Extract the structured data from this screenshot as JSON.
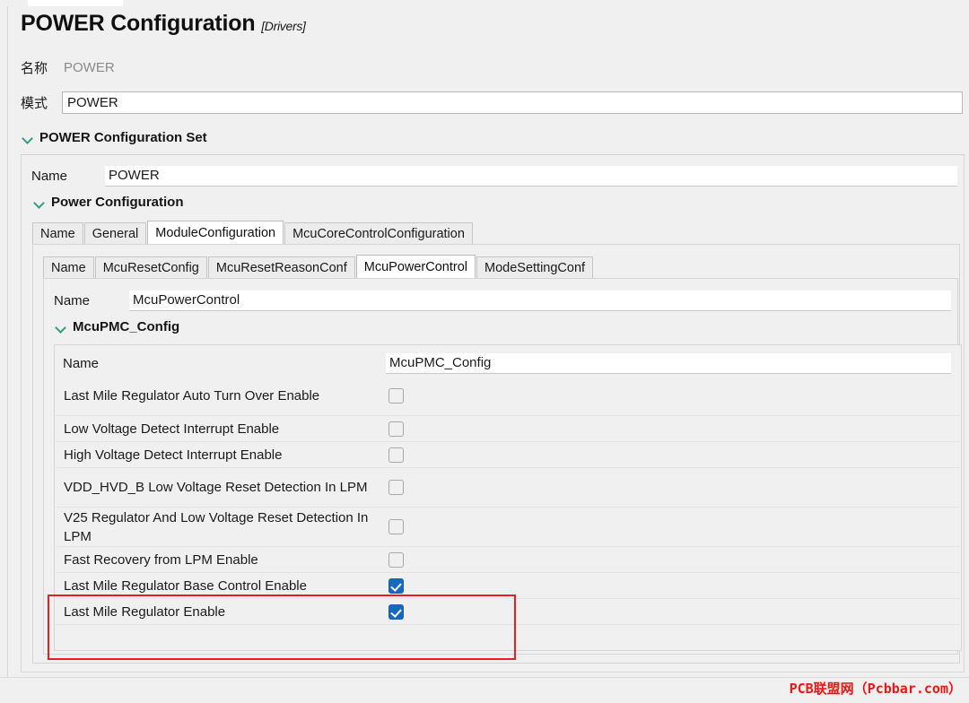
{
  "window": {
    "header_title": "POWER Configuration",
    "header_subtitle": "[Drivers]"
  },
  "form": {
    "name_label": "名称",
    "name_value": "POWER",
    "mode_label": "模式",
    "mode_value": "POWER"
  },
  "sections": {
    "power_configuration_set": "POWER Configuration Set",
    "power_configuration": "Power Configuration",
    "mcu_pmc_config": "McuPMC_Config"
  },
  "rows": {
    "set_name_label": "Name",
    "set_name_value": "POWER",
    "power_control_name_label": "Name",
    "power_control_name_value": "McuPowerControl",
    "pmc_name_label": "Name",
    "pmc_name_value": "McuPMC_Config"
  },
  "tabs_level1": [
    {
      "label": "Name",
      "active": false
    },
    {
      "label": "General",
      "active": false
    },
    {
      "label": "ModuleConfiguration",
      "active": true
    },
    {
      "label": "McuCoreControlConfiguration",
      "active": false
    }
  ],
  "tabs_level2": [
    {
      "label": "Name",
      "active": false
    },
    {
      "label": "McuResetConfig",
      "active": false
    },
    {
      "label": "McuResetReasonConf",
      "active": false
    },
    {
      "label": "McuPowerControl",
      "active": true
    },
    {
      "label": "ModeSettingConf",
      "active": false
    }
  ],
  "properties": [
    {
      "label": "Last Mile Regulator Auto Turn Over Enable",
      "checked": false,
      "multiline": true,
      "highlighted": false
    },
    {
      "label": "Low Voltage Detect Interrupt Enable",
      "checked": false,
      "multiline": false,
      "highlighted": false
    },
    {
      "label": "High Voltage Detect Interrupt Enable",
      "checked": false,
      "multiline": false,
      "highlighted": false
    },
    {
      "label": "VDD_HVD_B Low Voltage Reset Detection In LPM",
      "checked": false,
      "multiline": true,
      "highlighted": false
    },
    {
      "label": "V25 Regulator And Low Voltage Reset Detection In LPM",
      "checked": false,
      "multiline": true,
      "highlighted": false
    },
    {
      "label": "Fast Recovery from LPM Enable",
      "checked": false,
      "multiline": false,
      "highlighted": false
    },
    {
      "label": "Last Mile Regulator Base Control Enable",
      "checked": true,
      "multiline": false,
      "highlighted": true
    },
    {
      "label": "Last Mile Regulator Enable",
      "checked": true,
      "multiline": false,
      "highlighted": true
    }
  ],
  "watermark": "PCB联盟网（Pcbbar.com）",
  "colors": {
    "section_chevron": "#2e9e83",
    "checkbox_checked": "#1669c0",
    "annotation_box": "#ee1c1c",
    "watermark": "#f41414"
  }
}
